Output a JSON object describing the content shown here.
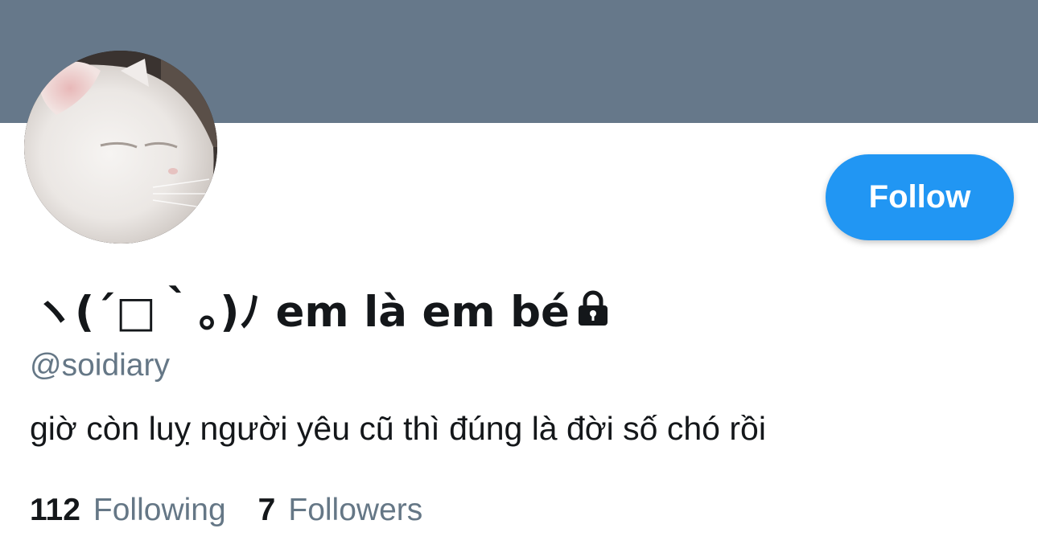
{
  "profile": {
    "display_name": "ヽ(´□｀。)ﾉ em là em bé",
    "handle": "@soidiary",
    "bio": "giờ còn luỵ người yêu cũ thì đúng là đời số chó rồi",
    "locked_icon": "lock-icon",
    "avatar_icon": "white-cat-photo"
  },
  "actions": {
    "follow_label": "Follow"
  },
  "stats": {
    "following_count": "112",
    "following_label": "Following",
    "followers_count": "7",
    "followers_label": "Followers"
  },
  "colors": {
    "banner": "#66788a",
    "accent": "#2196f3",
    "text_primary": "#14171a",
    "text_secondary": "#657786"
  }
}
